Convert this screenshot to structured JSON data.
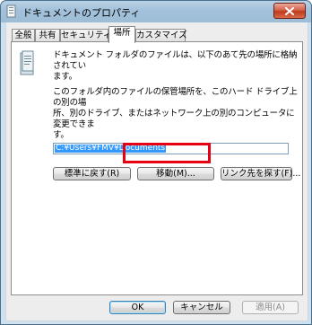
{
  "window": {
    "title": "ドキュメントのプロパティ",
    "close_symbol": "✕"
  },
  "tabs": [
    {
      "label": "全般",
      "active": false
    },
    {
      "label": "共有",
      "active": false
    },
    {
      "label": "セキュリティ",
      "active": false
    },
    {
      "label": "場所",
      "active": true
    },
    {
      "label": "カスタマイズ",
      "active": false
    }
  ],
  "location": {
    "description_1": [
      "ドキュメント フォルダのファイルは、以下のあて先の場所に格納されてい",
      "ます。"
    ],
    "description_2": [
      "このフォルダ内のファイルの保管場所を、このハード ドライブ上の別の場",
      "所、別のドライブ、またはネットワーク上の別のコンピュータに変更できま",
      "す。"
    ],
    "path": "C:¥Users¥FMV¥Documents",
    "restore_default_label": "標準に戻す(R)",
    "move_label": "移動(M)...",
    "find_target_label": "リンク先を探す(F)..."
  },
  "footer": {
    "ok_label": "OK",
    "cancel_label": "キャンセル",
    "apply_label": "適用(A)"
  },
  "colors": {
    "highlight": "#e60012",
    "selection": "#3399ff"
  },
  "icons": {
    "title": "folder-properties-icon",
    "panel": "documents-folder-icon",
    "close": "close-icon"
  }
}
